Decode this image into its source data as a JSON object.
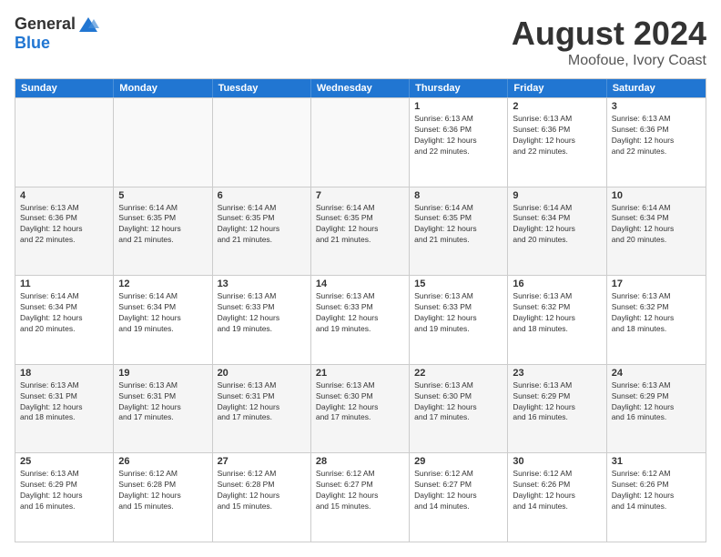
{
  "logo": {
    "general": "General",
    "blue": "Blue"
  },
  "title": {
    "month": "August 2024",
    "location": "Moofoue, Ivory Coast"
  },
  "header_days": [
    "Sunday",
    "Monday",
    "Tuesday",
    "Wednesday",
    "Thursday",
    "Friday",
    "Saturday"
  ],
  "weeks": [
    [
      {
        "day": "",
        "empty": true
      },
      {
        "day": "",
        "empty": true
      },
      {
        "day": "",
        "empty": true
      },
      {
        "day": "",
        "empty": true
      },
      {
        "day": "1",
        "info": "Sunrise: 6:13 AM\nSunset: 6:36 PM\nDaylight: 12 hours\nand 22 minutes."
      },
      {
        "day": "2",
        "info": "Sunrise: 6:13 AM\nSunset: 6:36 PM\nDaylight: 12 hours\nand 22 minutes."
      },
      {
        "day": "3",
        "info": "Sunrise: 6:13 AM\nSunset: 6:36 PM\nDaylight: 12 hours\nand 22 minutes."
      }
    ],
    [
      {
        "day": "4",
        "info": "Sunrise: 6:13 AM\nSunset: 6:36 PM\nDaylight: 12 hours\nand 22 minutes."
      },
      {
        "day": "5",
        "info": "Sunrise: 6:14 AM\nSunset: 6:35 PM\nDaylight: 12 hours\nand 21 minutes."
      },
      {
        "day": "6",
        "info": "Sunrise: 6:14 AM\nSunset: 6:35 PM\nDaylight: 12 hours\nand 21 minutes."
      },
      {
        "day": "7",
        "info": "Sunrise: 6:14 AM\nSunset: 6:35 PM\nDaylight: 12 hours\nand 21 minutes."
      },
      {
        "day": "8",
        "info": "Sunrise: 6:14 AM\nSunset: 6:35 PM\nDaylight: 12 hours\nand 21 minutes."
      },
      {
        "day": "9",
        "info": "Sunrise: 6:14 AM\nSunset: 6:34 PM\nDaylight: 12 hours\nand 20 minutes."
      },
      {
        "day": "10",
        "info": "Sunrise: 6:14 AM\nSunset: 6:34 PM\nDaylight: 12 hours\nand 20 minutes."
      }
    ],
    [
      {
        "day": "11",
        "info": "Sunrise: 6:14 AM\nSunset: 6:34 PM\nDaylight: 12 hours\nand 20 minutes."
      },
      {
        "day": "12",
        "info": "Sunrise: 6:14 AM\nSunset: 6:34 PM\nDaylight: 12 hours\nand 19 minutes."
      },
      {
        "day": "13",
        "info": "Sunrise: 6:13 AM\nSunset: 6:33 PM\nDaylight: 12 hours\nand 19 minutes."
      },
      {
        "day": "14",
        "info": "Sunrise: 6:13 AM\nSunset: 6:33 PM\nDaylight: 12 hours\nand 19 minutes."
      },
      {
        "day": "15",
        "info": "Sunrise: 6:13 AM\nSunset: 6:33 PM\nDaylight: 12 hours\nand 19 minutes."
      },
      {
        "day": "16",
        "info": "Sunrise: 6:13 AM\nSunset: 6:32 PM\nDaylight: 12 hours\nand 18 minutes."
      },
      {
        "day": "17",
        "info": "Sunrise: 6:13 AM\nSunset: 6:32 PM\nDaylight: 12 hours\nand 18 minutes."
      }
    ],
    [
      {
        "day": "18",
        "info": "Sunrise: 6:13 AM\nSunset: 6:31 PM\nDaylight: 12 hours\nand 18 minutes."
      },
      {
        "day": "19",
        "info": "Sunrise: 6:13 AM\nSunset: 6:31 PM\nDaylight: 12 hours\nand 17 minutes."
      },
      {
        "day": "20",
        "info": "Sunrise: 6:13 AM\nSunset: 6:31 PM\nDaylight: 12 hours\nand 17 minutes."
      },
      {
        "day": "21",
        "info": "Sunrise: 6:13 AM\nSunset: 6:30 PM\nDaylight: 12 hours\nand 17 minutes."
      },
      {
        "day": "22",
        "info": "Sunrise: 6:13 AM\nSunset: 6:30 PM\nDaylight: 12 hours\nand 17 minutes."
      },
      {
        "day": "23",
        "info": "Sunrise: 6:13 AM\nSunset: 6:29 PM\nDaylight: 12 hours\nand 16 minutes."
      },
      {
        "day": "24",
        "info": "Sunrise: 6:13 AM\nSunset: 6:29 PM\nDaylight: 12 hours\nand 16 minutes."
      }
    ],
    [
      {
        "day": "25",
        "info": "Sunrise: 6:13 AM\nSunset: 6:29 PM\nDaylight: 12 hours\nand 16 minutes."
      },
      {
        "day": "26",
        "info": "Sunrise: 6:12 AM\nSunset: 6:28 PM\nDaylight: 12 hours\nand 15 minutes."
      },
      {
        "day": "27",
        "info": "Sunrise: 6:12 AM\nSunset: 6:28 PM\nDaylight: 12 hours\nand 15 minutes."
      },
      {
        "day": "28",
        "info": "Sunrise: 6:12 AM\nSunset: 6:27 PM\nDaylight: 12 hours\nand 15 minutes."
      },
      {
        "day": "29",
        "info": "Sunrise: 6:12 AM\nSunset: 6:27 PM\nDaylight: 12 hours\nand 14 minutes."
      },
      {
        "day": "30",
        "info": "Sunrise: 6:12 AM\nSunset: 6:26 PM\nDaylight: 12 hours\nand 14 minutes."
      },
      {
        "day": "31",
        "info": "Sunrise: 6:12 AM\nSunset: 6:26 PM\nDaylight: 12 hours\nand 14 minutes."
      }
    ]
  ]
}
